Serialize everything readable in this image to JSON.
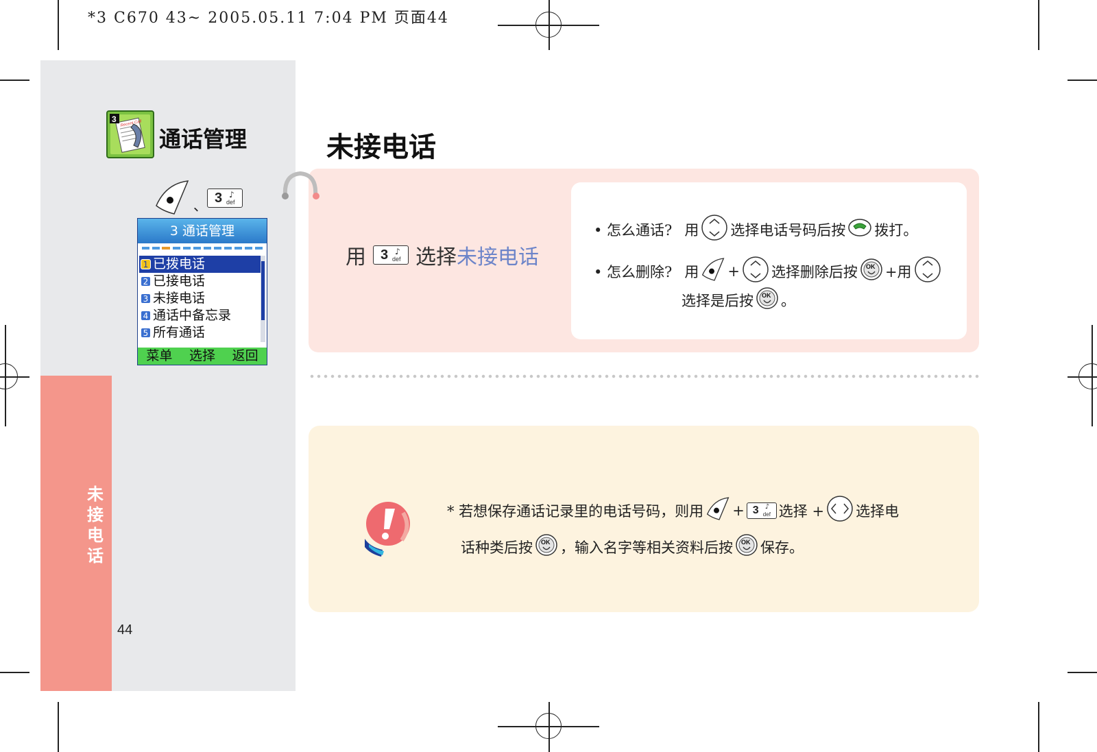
{
  "print_header": "*3 C670 43~ 2005.05.11 7:04 PM 页面44",
  "sidebar": {
    "section_title": "通话管理",
    "key_separator": "、",
    "side_tab": "未接电话",
    "page_number": "44"
  },
  "key3": {
    "digit": "3",
    "letters": "def"
  },
  "phone_screen": {
    "header": "3 通话管理",
    "items": [
      {
        "num": "1",
        "label": "已拨电话"
      },
      {
        "num": "2",
        "label": "已接电话"
      },
      {
        "num": "3",
        "label": "未接电话"
      },
      {
        "num": "4",
        "label": "通话中备忘录"
      },
      {
        "num": "5",
        "label": "所有通话"
      }
    ],
    "selected_index": 0,
    "softkeys": [
      "菜单",
      "选择",
      "返回"
    ]
  },
  "main": {
    "title": "未接电话",
    "instruction": {
      "prefix": "用",
      "middle": "选择",
      "highlight": "未接电话"
    },
    "tips": {
      "call": {
        "q": "• 怎么通话?",
        "p1": "用",
        "p2": "选择电话号码后按",
        "p3": "拨打。"
      },
      "delete": {
        "q": "• 怎么删除?",
        "p1": "用",
        "plus1": "+",
        "p2": "选择删除后按",
        "p3": "+用",
        "line2a": "选择是后按",
        "line2b": "。"
      }
    },
    "note": {
      "line1_a": "* 若想保存通话记录里的电话号码，则用",
      "line1_b": "+",
      "line1_c": "选择 +",
      "line1_d": "选择电",
      "line2_a": "话种类后按",
      "line2_b": "，输入名字等相关资料后按",
      "line2_c": "保存。"
    }
  },
  "colors": {
    "left_bg": "#e8e9eb",
    "side_tab": "#f4968b",
    "pink_box": "#fde6e1",
    "yellow_box": "#fdf3df",
    "highlight_text": "#6c84c9",
    "phone_header": "#2b79c9",
    "phone_softkeys": "#4fd14f"
  },
  "icons": [
    "call-log-icon",
    "menu-key-icon",
    "number-3-key-icon",
    "navigation-key-icon",
    "send-key-icon",
    "ok-key-icon",
    "left-right-key-icon",
    "exclamation-icon"
  ]
}
